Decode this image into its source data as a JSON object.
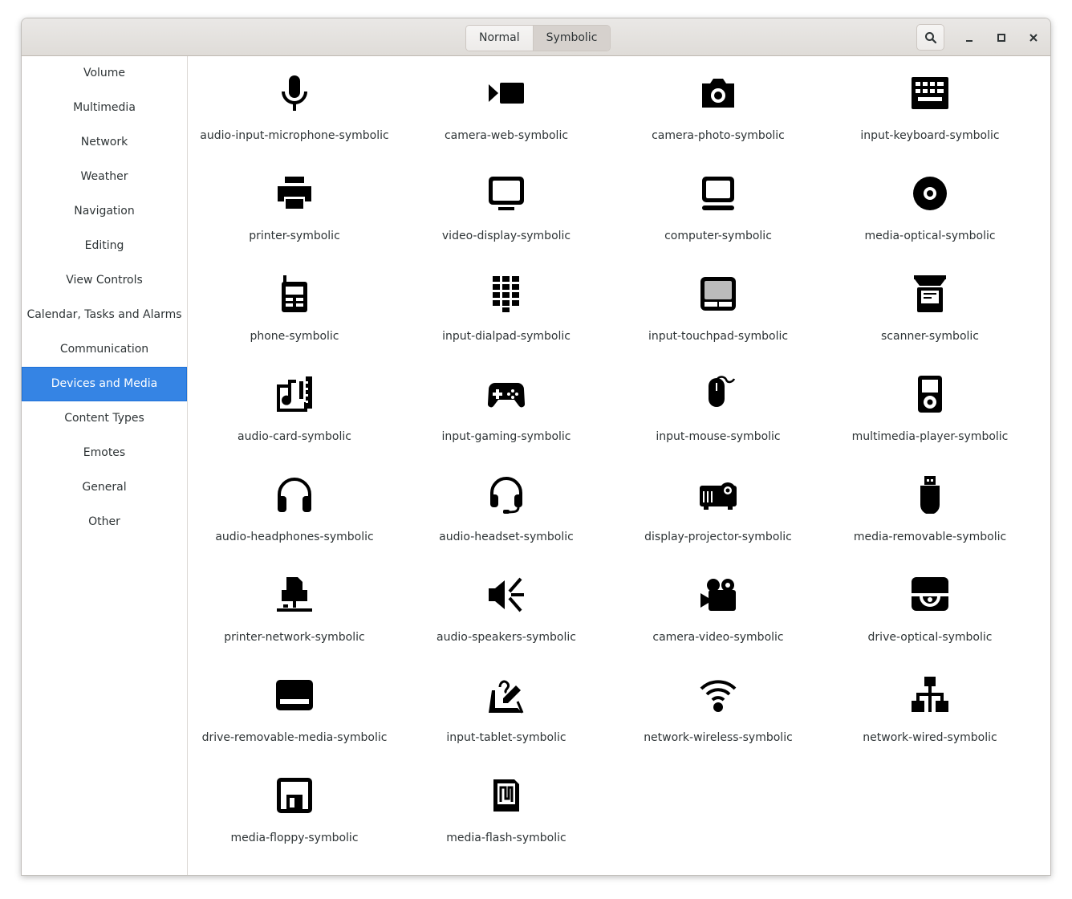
{
  "header": {
    "tabs": [
      {
        "label": "Normal"
      },
      {
        "label": "Symbolic"
      }
    ]
  },
  "sidebar": {
    "items": [
      {
        "label": "Volume"
      },
      {
        "label": "Multimedia"
      },
      {
        "label": "Network"
      },
      {
        "label": "Weather"
      },
      {
        "label": "Navigation"
      },
      {
        "label": "Editing"
      },
      {
        "label": "View Controls"
      },
      {
        "label": "Calendar, Tasks and Alarms"
      },
      {
        "label": "Communication"
      },
      {
        "label": "Devices and Media"
      },
      {
        "label": "Content Types"
      },
      {
        "label": "Emotes"
      },
      {
        "label": "General"
      },
      {
        "label": "Other"
      }
    ],
    "selected": "Devices and Media"
  },
  "icons": [
    {
      "label": "audio-input-microphone-symbolic"
    },
    {
      "label": "camera-web-symbolic"
    },
    {
      "label": "camera-photo-symbolic"
    },
    {
      "label": "input-keyboard-symbolic"
    },
    {
      "label": "printer-symbolic"
    },
    {
      "label": "video-display-symbolic"
    },
    {
      "label": "computer-symbolic"
    },
    {
      "label": "media-optical-symbolic"
    },
    {
      "label": "phone-symbolic"
    },
    {
      "label": "input-dialpad-symbolic"
    },
    {
      "label": "input-touchpad-symbolic"
    },
    {
      "label": "scanner-symbolic"
    },
    {
      "label": "audio-card-symbolic"
    },
    {
      "label": "input-gaming-symbolic"
    },
    {
      "label": "input-mouse-symbolic"
    },
    {
      "label": "multimedia-player-symbolic"
    },
    {
      "label": "audio-headphones-symbolic"
    },
    {
      "label": "audio-headset-symbolic"
    },
    {
      "label": "display-projector-symbolic"
    },
    {
      "label": "media-removable-symbolic"
    },
    {
      "label": "printer-network-symbolic"
    },
    {
      "label": "audio-speakers-symbolic"
    },
    {
      "label": "camera-video-symbolic"
    },
    {
      "label": "drive-optical-symbolic"
    },
    {
      "label": "drive-removable-media-symbolic"
    },
    {
      "label": "input-tablet-symbolic"
    },
    {
      "label": "network-wireless-symbolic"
    },
    {
      "label": "network-wired-symbolic"
    },
    {
      "label": "media-floppy-symbolic"
    },
    {
      "label": "media-flash-symbolic"
    }
  ],
  "colors": {
    "accent": "#3584e4",
    "icon": "#000000",
    "text": "#2e3436"
  }
}
